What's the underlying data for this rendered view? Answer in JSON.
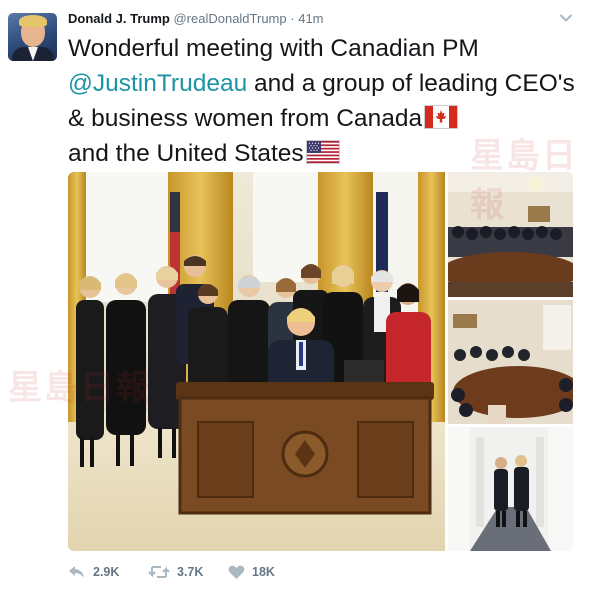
{
  "tweet": {
    "author_name": "Donald J. Trump",
    "handle": "@realDonaldTrump",
    "separator": "·",
    "time": "41m",
    "text_part1": "Wonderful meeting with Canadian PM ",
    "mention": "@JustinTrudeau",
    "text_part2": " and a group of leading CEO's & business women from Canada",
    "text_part3": "and the United States",
    "emoji": [
      "canada-flag",
      "us-flag"
    ]
  },
  "watermark": {
    "text": "星島日報"
  },
  "photos": [
    {
      "subject": "oval-office-group"
    },
    {
      "subject": "cabinet-room-meeting"
    },
    {
      "subject": "roundtable-meeting"
    },
    {
      "subject": "colonnade-walk"
    }
  ],
  "actions": {
    "reply_count": "",
    "retweet_count": "3.7K",
    "like_count": "18K",
    "reply_label": "2.9K"
  },
  "colors": {
    "mention": "#1b95a6",
    "meta": "#657786",
    "text": "#14171a"
  }
}
